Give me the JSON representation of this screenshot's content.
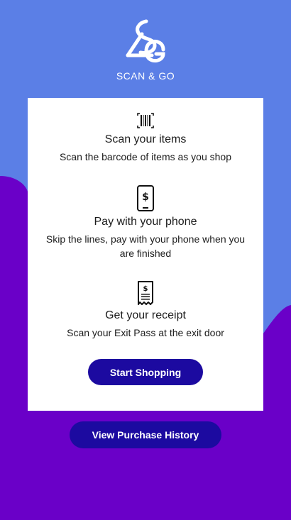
{
  "app": {
    "logo_text": "SCAN & GO",
    "logo_icon": "sg-logo-icon"
  },
  "colors": {
    "background_top": "#5b7fe6",
    "background_bottom": "#6a00c8",
    "button": "#1c0aa0",
    "card": "#ffffff"
  },
  "steps": [
    {
      "icon": "barcode-icon",
      "title": "Scan your items",
      "description": "Scan the barcode of items as you shop"
    },
    {
      "icon": "phone-dollar-icon",
      "title": "Pay with your phone",
      "description": "Skip the lines, pay with your phone when you are finished"
    },
    {
      "icon": "receipt-icon",
      "title": "Get your receipt",
      "description": "Scan your Exit Pass at the exit door"
    }
  ],
  "buttons": {
    "start_shopping": "Start Shopping",
    "view_history": "View Purchase History"
  }
}
